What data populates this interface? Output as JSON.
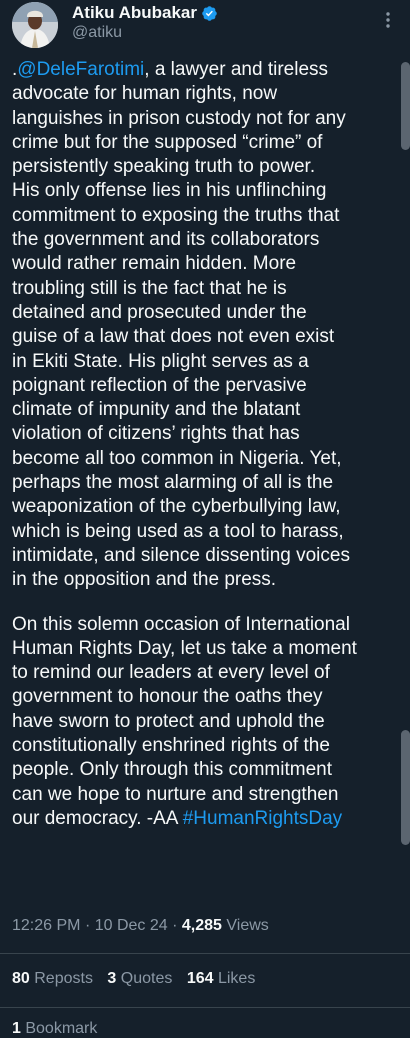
{
  "author": {
    "name": "Atiku Abubakar",
    "handle": "@atiku"
  },
  "tweet": {
    "prefix": ".",
    "mention": "@DeleFarotimi",
    "para1_rest": ", a lawyer and tireless\nadvocate for human rights, now\nlanguishes in prison custody not for any\ncrime but for the supposed “crime” of\npersistently speaking truth to power.\nHis only offense lies in his unflinching\ncommitment to exposing the truths that\nthe government and its collaborators\nwould rather remain hidden. More\ntroubling still is the fact that he is\ndetained and prosecuted under the\nguise of a law that does not even exist\nin Ekiti State. His plight serves as a\npoignant reflection of the pervasive\nclimate of impunity and the blatant\nviolation of citizens’ rights that has\nbecome all too common in Nigeria. Yet,\nperhaps the most alarming of all is the\nweaponization of the cyberbullying law,\nwhich is being used as a tool to harass,\nintimidate, and silence dissenting voices\nin the opposition and the press.",
    "para2": "On this solemn occasion of International\nHuman Rights Day, let us take a moment\nto remind our leaders at every level of\ngovernment to honour the oaths they\nhave sworn to protect and uphold the\nconstitutionally enshrined rights of the\npeople. Only through this commitment\ncan we hope to nurture and strengthen\nour democracy. -AA ",
    "hashtag": "#HumanRightsDay"
  },
  "meta": {
    "time": "12:26 PM",
    "sep1": "·",
    "date": "10 Dec 24",
    "sep2": "·",
    "views_count": "4,285",
    "views_label": "Views"
  },
  "stats": {
    "reposts_count": "80",
    "reposts_label": "Reposts",
    "quotes_count": "3",
    "quotes_label": "Quotes",
    "likes_count": "164",
    "likes_label": "Likes"
  },
  "bookmarks": {
    "count": "1",
    "label": "Bookmark"
  },
  "colors": {
    "background": "#15202b",
    "text": "#f7f9f9",
    "secondary": "#8b98a5",
    "link": "#1d9bf0",
    "divider": "#38444d"
  },
  "icons": {
    "verified": "verified-badge-icon",
    "more": "more-options-icon"
  }
}
